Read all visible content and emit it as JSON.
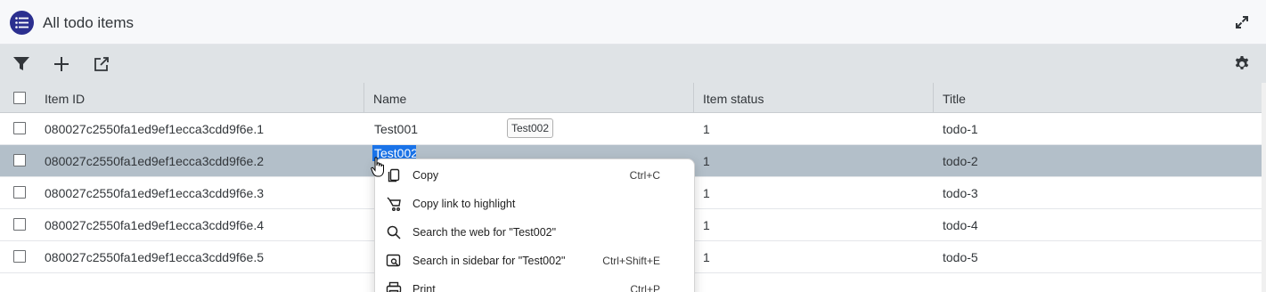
{
  "header": {
    "title": "All todo items",
    "app_icon": "list-icon",
    "expand_icon": "expand-icon"
  },
  "toolbar": {
    "filter_icon": "filter-icon",
    "add_icon": "plus-icon",
    "export_icon": "open-external-icon",
    "settings_icon": "gear-icon"
  },
  "table": {
    "columns": [
      "Item ID",
      "Name",
      "Item status",
      "Title"
    ],
    "rows": [
      {
        "id": "080027c2550fa1ed9ef1ecca3cdd9f6e.1",
        "name": "Test001",
        "status": "1",
        "title": "todo-1",
        "selected": false
      },
      {
        "id": "080027c2550fa1ed9ef1ecca3cdd9f6e.2",
        "name": "Test002",
        "status": "1",
        "title": "todo-2",
        "selected": true
      },
      {
        "id": "080027c2550fa1ed9ef1ecca3cdd9f6e.3",
        "name": "",
        "status": "1",
        "title": "todo-3",
        "selected": false
      },
      {
        "id": "080027c2550fa1ed9ef1ecca3cdd9f6e.4",
        "name": "",
        "status": "1",
        "title": "todo-4",
        "selected": false
      },
      {
        "id": "080027c2550fa1ed9ef1ecca3cdd9f6e.5",
        "name": "",
        "status": "1",
        "title": "todo-5",
        "selected": false
      }
    ]
  },
  "tooltip": {
    "text": "Test002"
  },
  "context_menu": {
    "items": [
      {
        "label": "Copy",
        "shortcut": "Ctrl+C",
        "icon": "copy-icon"
      },
      {
        "label": "Copy link to highlight",
        "shortcut": "",
        "icon": "link-highlight-icon"
      },
      {
        "label": "Search the web for \"Test002\"",
        "shortcut": "",
        "icon": "search-icon"
      },
      {
        "label": "Search in sidebar for \"Test002\"",
        "shortcut": "Ctrl+Shift+E",
        "icon": "sidebar-search-icon"
      },
      {
        "label": "Print",
        "shortcut": "Ctrl+P",
        "icon": "print-icon"
      }
    ]
  },
  "colors": {
    "app_icon_bg": "#2b2f8f",
    "selected_row": "#b3bfc9",
    "text_selection": "#1a73e8"
  }
}
